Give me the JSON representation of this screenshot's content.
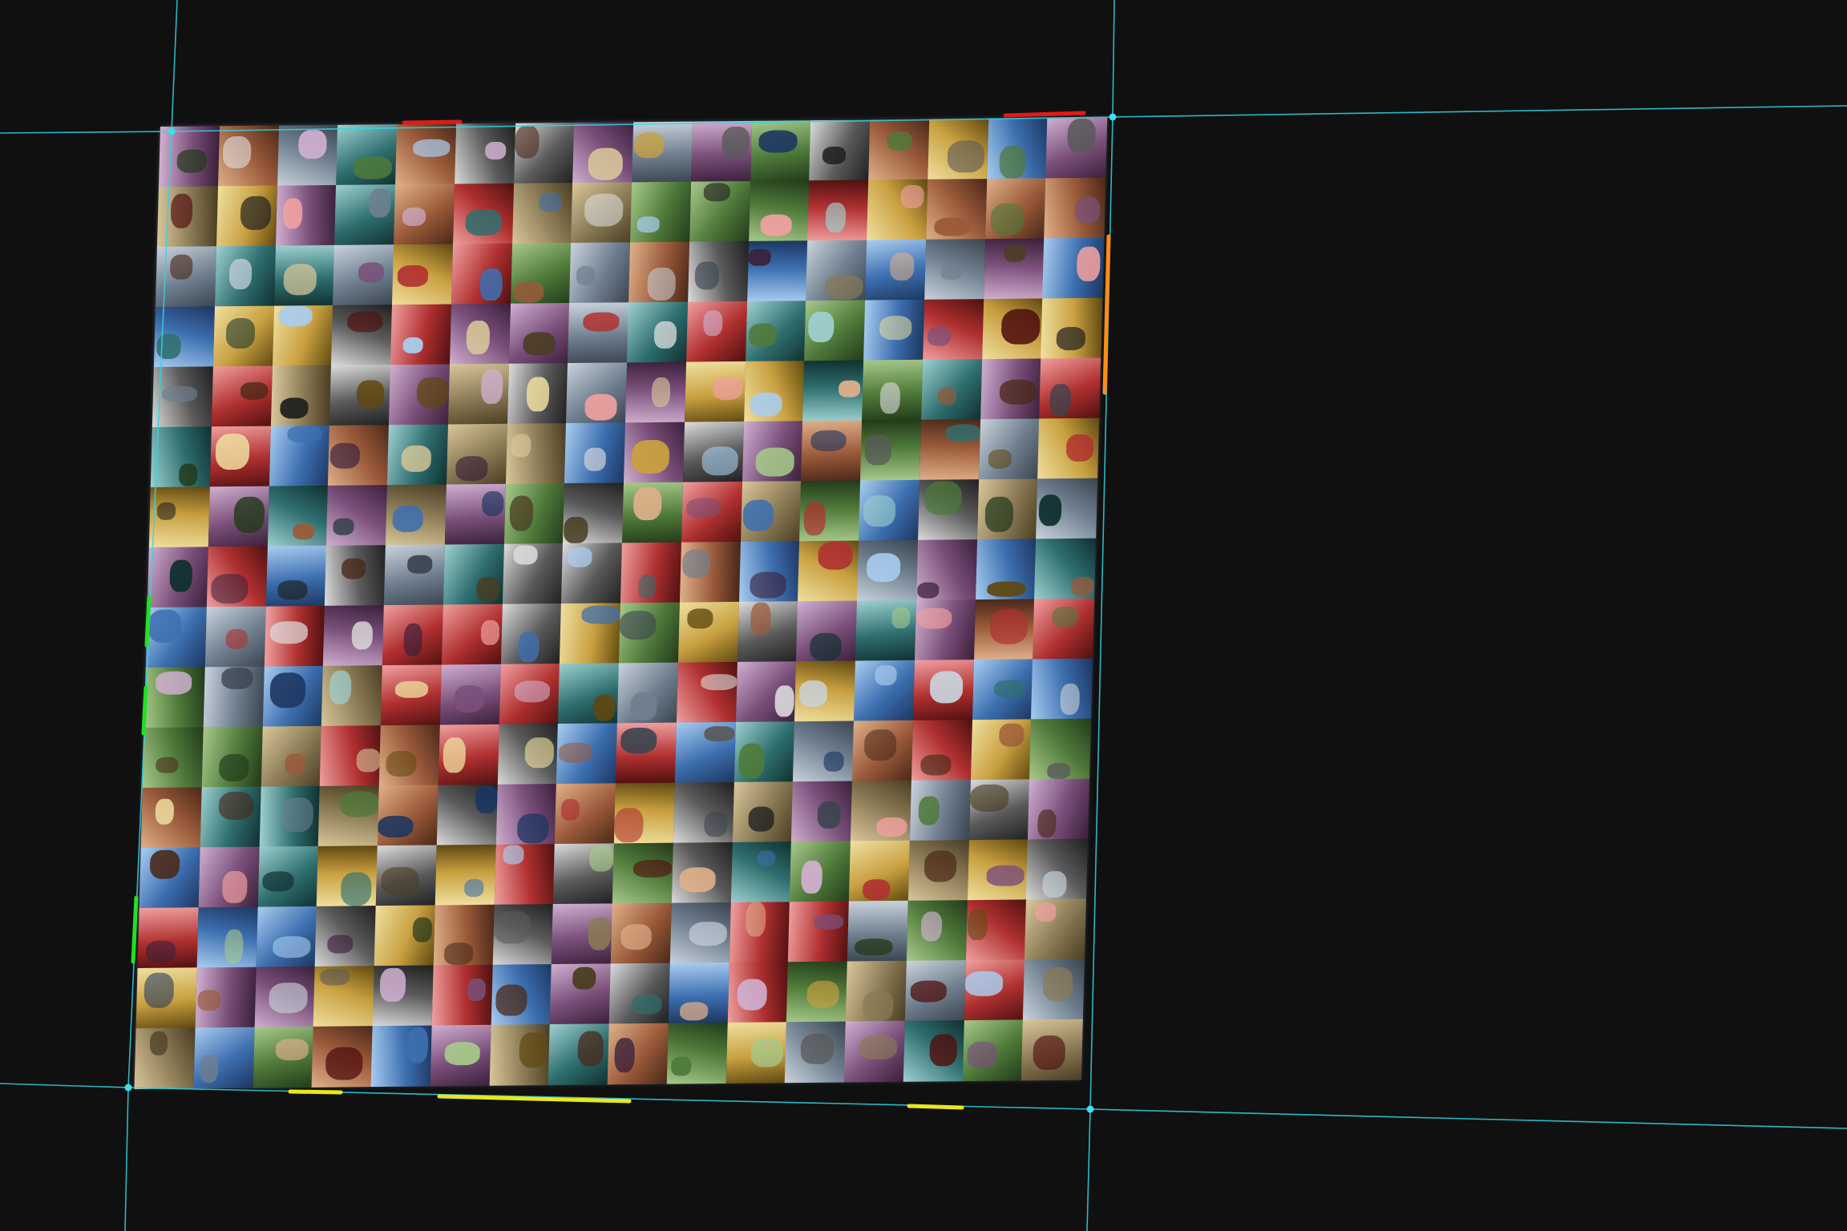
{
  "image": {
    "description_kind": "photo of a screen showing a mosaic of small thumbnails",
    "mosaic": {
      "rows": 16,
      "cols": 16
    },
    "colors": {
      "background": "#101010",
      "guide_line": "#2fd6e6",
      "corner_marker": "#3ee0ee",
      "edge_red": "#e11a1a",
      "edge_orange": "#ff8c1a",
      "edge_green": "#22e022",
      "edge_yellow": "#e8e81a"
    }
  }
}
